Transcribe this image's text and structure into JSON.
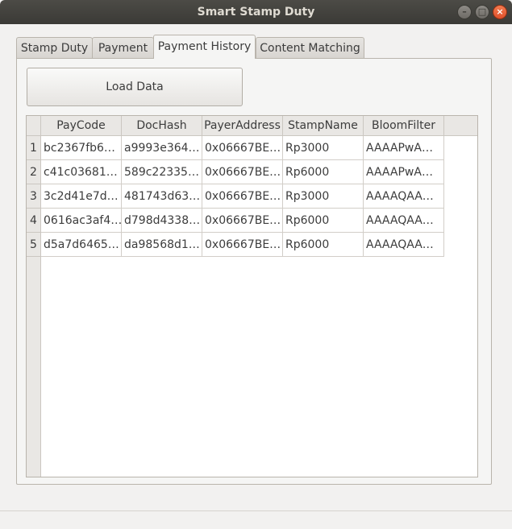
{
  "window": {
    "title": "Smart Stamp Duty",
    "min_glyph": "–",
    "max_glyph": "□",
    "close_glyph": "×"
  },
  "tabs": [
    {
      "label": "Stamp Duty"
    },
    {
      "label": "Payment"
    },
    {
      "label": "Payment History",
      "active": true
    },
    {
      "label": "Content Matching"
    }
  ],
  "load_button": {
    "label": "Load Data"
  },
  "table": {
    "columns": [
      "PayCode",
      "DocHash",
      "PayerAddress",
      "StampName",
      "BloomFilter"
    ],
    "rows": [
      {
        "num": "1",
        "cells": [
          "bc2367fb6…",
          "a9993e364…",
          "0x06667BE…",
          "Rp3000",
          "AAAAPwA…"
        ]
      },
      {
        "num": "2",
        "cells": [
          "c41c03681…",
          "589c22335…",
          "0x06667BE…",
          "Rp6000",
          "AAAAPwA…"
        ]
      },
      {
        "num": "3",
        "cells": [
          "3c2d41e7d…",
          "481743d63…",
          "0x06667BE…",
          "Rp3000",
          "AAAAQAA…"
        ]
      },
      {
        "num": "4",
        "cells": [
          "0616ac3af4…",
          "d798d4338…",
          "0x06667BE…",
          "Rp6000",
          "AAAAQAA…"
        ]
      },
      {
        "num": "5",
        "cells": [
          "d5a7d6465…",
          "da98568d1…",
          "0x06667BE…",
          "Rp6000",
          "AAAAQAA…"
        ]
      }
    ]
  }
}
